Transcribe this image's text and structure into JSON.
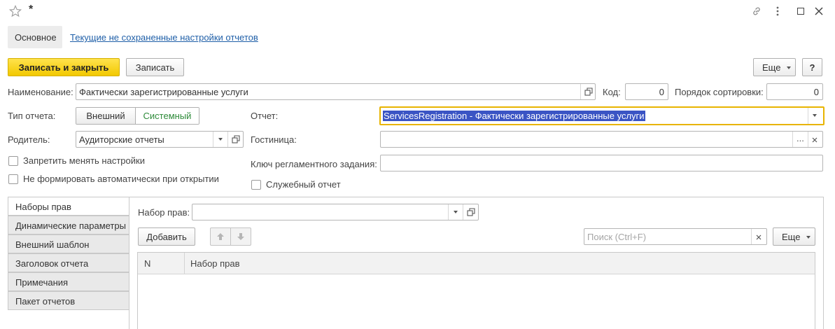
{
  "window": {
    "title": "*",
    "icons": [
      "star-icon",
      "link-icon",
      "more-vert-icon",
      "maximize-icon",
      "close-icon"
    ]
  },
  "tabs_top": {
    "main": "Основное",
    "link": "Текущие не сохраненные настройки отчетов"
  },
  "toolbar": {
    "save_close": "Записать и закрыть",
    "save": "Записать",
    "more": "Еще",
    "help": "?"
  },
  "form": {
    "name_label": "Наименование:",
    "name_value": "Фактически зарегистрированные услуги",
    "code_label": "Код:",
    "code_value": "0",
    "sort_label": "Порядок сортировки:",
    "sort_value": "0",
    "type_label": "Тип отчета:",
    "type_external": "Внешний",
    "type_system": "Системный",
    "report_label": "Отчет:",
    "report_value": "ServicesRegistration - Фактически зарегистрированные услуги",
    "parent_label": "Родитель:",
    "parent_value": "Аудиторские отчеты",
    "hotel_label": "Гостиница:",
    "hotel_value": "",
    "forbid_label": "Запретить менять настройки",
    "noauto_label": "Не формировать автоматически при открытии",
    "key_label": "Ключ регламентного задания:",
    "key_value": "",
    "service_label": "Служебный отчет"
  },
  "side_tabs": [
    "Наборы прав",
    "Динамические параметры",
    "Внешний шаблон",
    "Заголовок отчета",
    "Примечания",
    "Пакет отчетов"
  ],
  "panel": {
    "set_label": "Набор прав:",
    "set_value": "",
    "add": "Добавить",
    "search_placeholder": "Поиск (Ctrl+F)",
    "more": "Еще",
    "columns": [
      "N",
      "Набор прав"
    ]
  },
  "colors": {
    "accent_yellow": "#f5d000",
    "link": "#1f5fa8",
    "green": "#2e8b3a",
    "selection": "#3a54c4",
    "focus": "#e8b400"
  }
}
